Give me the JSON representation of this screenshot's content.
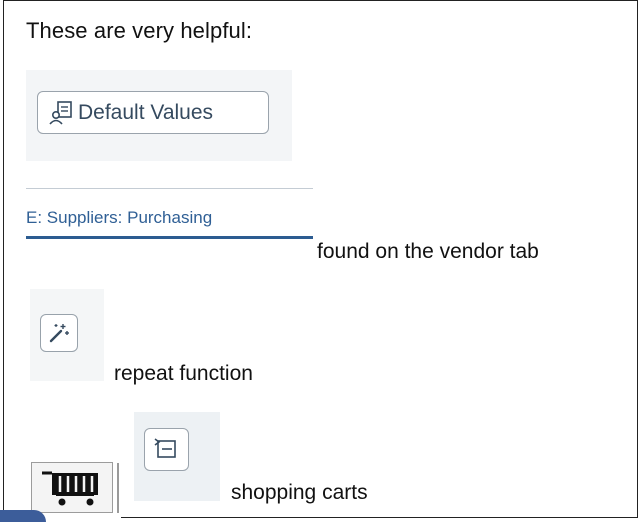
{
  "intro": "These are very helpful:",
  "default_values": {
    "label": "Default Values",
    "icon": "default-values-icon"
  },
  "supplier_tab": {
    "label": "E: Suppliers: Purchasing",
    "caption": "found on the vendor tab"
  },
  "repeat": {
    "icon": "magic-wand-icon",
    "caption": "repeat function"
  },
  "carts": {
    "icons": [
      "shopping-cart-icon",
      "command-field-icon"
    ],
    "caption": "shopping carts"
  },
  "colors": {
    "sap_text": "#354a5f",
    "tab_blue": "#2f5f95",
    "accent": "#3c5d9a"
  }
}
